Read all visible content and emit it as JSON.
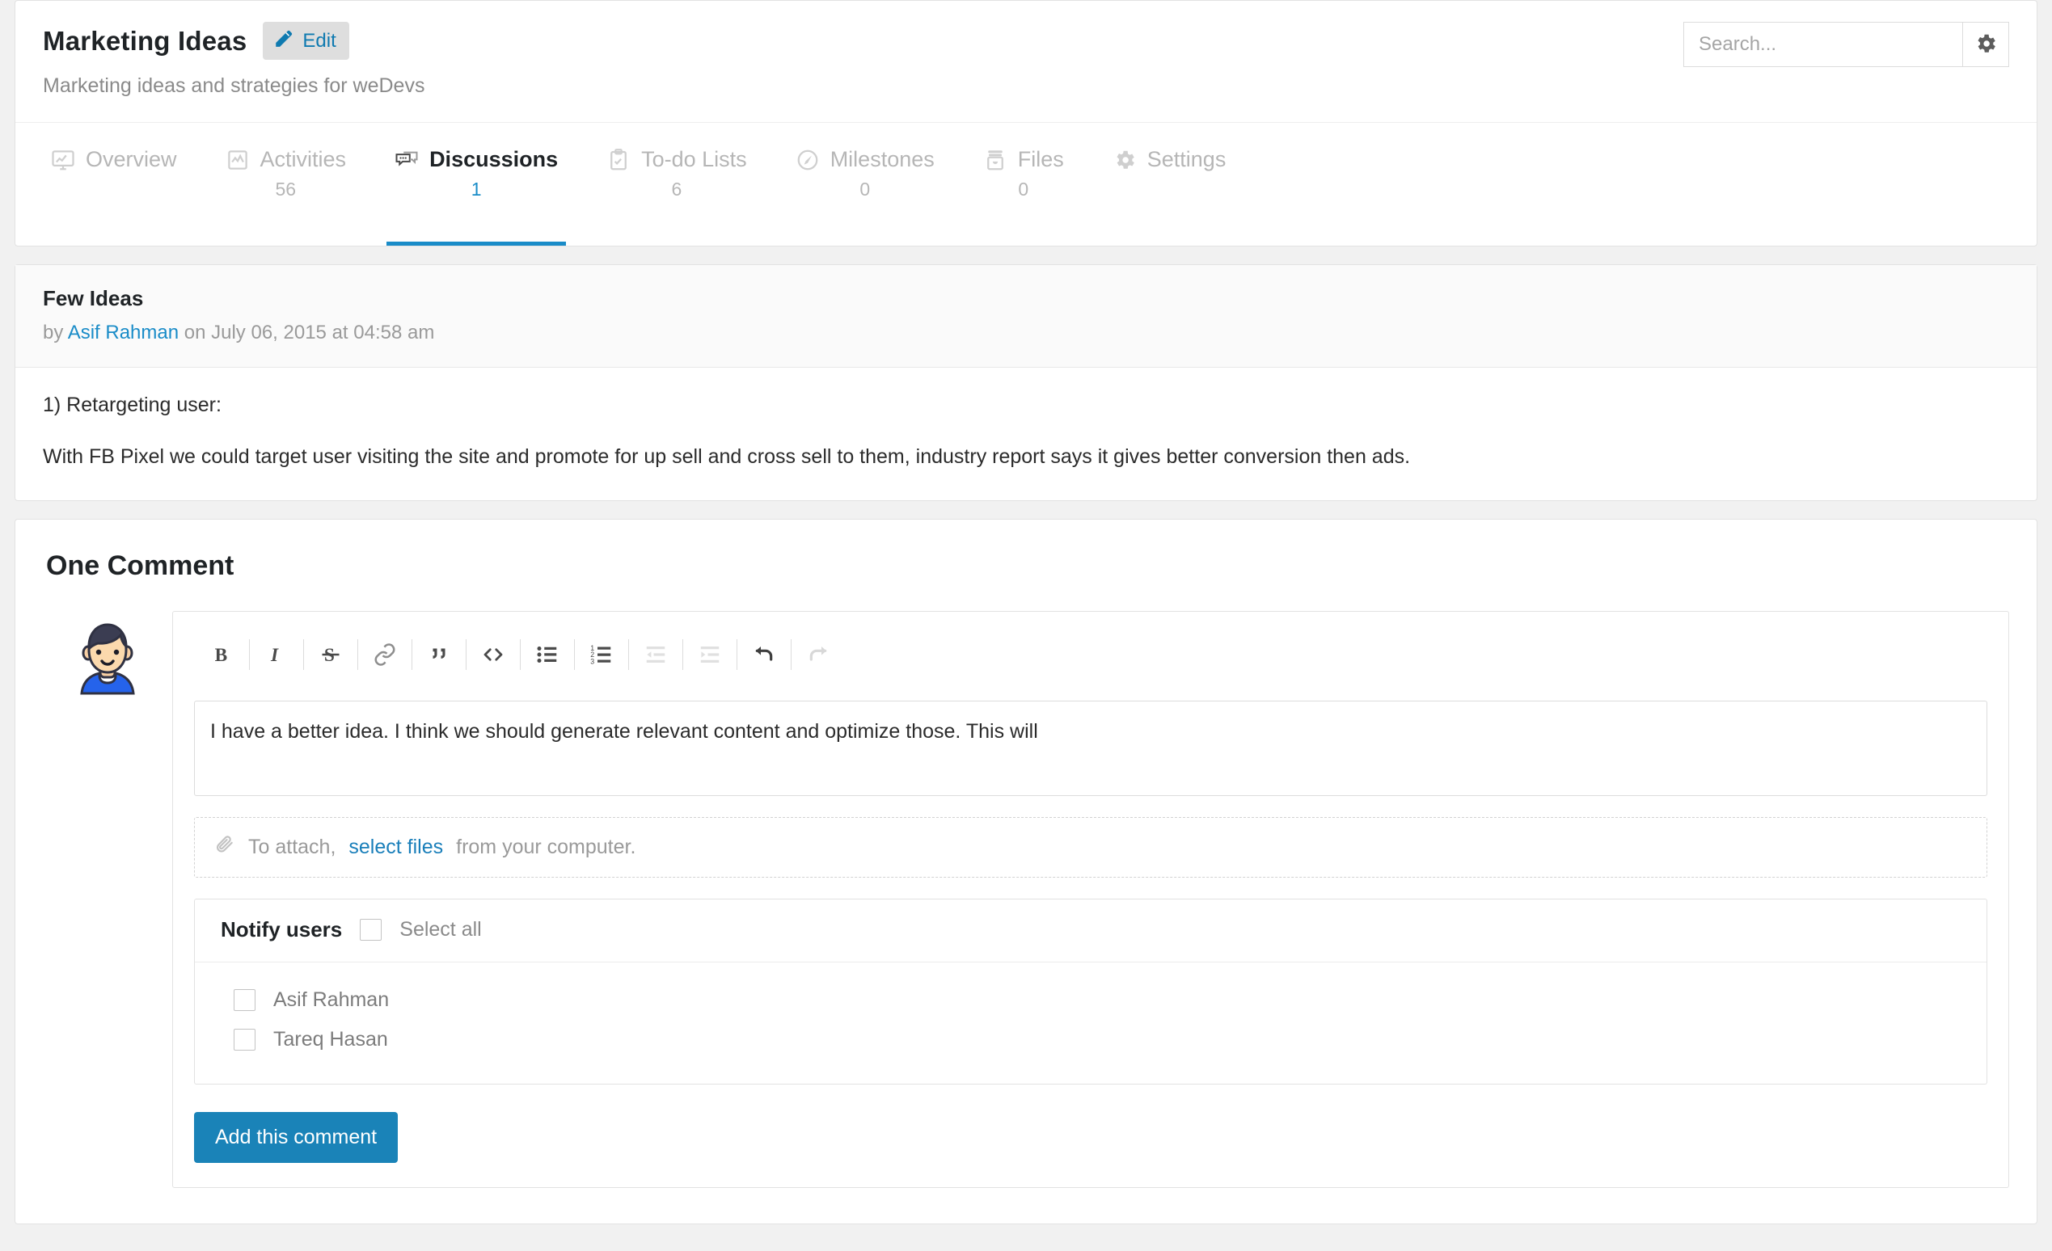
{
  "header": {
    "project_title": "Marketing Ideas",
    "edit_label": "Edit",
    "edit_icon": "pencil-icon",
    "project_subtitle": "Marketing ideas and strategies for weDevs",
    "search_placeholder": "Search...",
    "search_value": "",
    "settings_icon": "gear-icon"
  },
  "tabs": [
    {
      "label": "Overview",
      "count": "",
      "icon": "monitor-chart-icon",
      "active": false
    },
    {
      "label": "Activities",
      "count": "56",
      "icon": "activity-graph-icon",
      "active": false
    },
    {
      "label": "Discussions",
      "count": "1",
      "icon": "comment-bubbles-icon",
      "active": true
    },
    {
      "label": "To-do Lists",
      "count": "6",
      "icon": "clipboard-check-icon",
      "active": false
    },
    {
      "label": "Milestones",
      "count": "0",
      "icon": "speedometer-icon",
      "active": false
    },
    {
      "label": "Files",
      "count": "0",
      "icon": "archive-box-icon",
      "active": false
    },
    {
      "label": "Settings",
      "count": "",
      "icon": "gear-icon",
      "active": false
    }
  ],
  "discussion": {
    "title": "Few Ideas",
    "by_prefix": "by",
    "author": "Asif Rahman",
    "date_text": "on July 06, 2015 at 04:58 am",
    "paragraphs": [
      "1) Retargeting user:",
      "With FB Pixel we could target user visiting the site and promote for up sell and cross sell to them, industry report says it gives better conversion then ads."
    ]
  },
  "comments": {
    "heading": "One Comment",
    "avatar_icon": "user-avatar-illustration",
    "toolbar": [
      {
        "name": "bold-icon",
        "title": "Bold",
        "disabled": false
      },
      {
        "name": "italic-icon",
        "title": "Italic",
        "disabled": false
      },
      {
        "name": "strikethrough-icon",
        "title": "Strikethrough",
        "disabled": false
      },
      {
        "name": "link-icon",
        "title": "Link",
        "disabled": false
      },
      {
        "name": "quote-icon",
        "title": "Blockquote",
        "disabled": false
      },
      {
        "name": "code-icon",
        "title": "Code",
        "disabled": false
      },
      {
        "name": "bullet-list-icon",
        "title": "Bulleted list",
        "disabled": false
      },
      {
        "name": "numbered-list-icon",
        "title": "Numbered list",
        "disabled": false
      },
      {
        "name": "outdent-icon",
        "title": "Outdent",
        "disabled": true
      },
      {
        "name": "indent-icon",
        "title": "Indent",
        "disabled": true
      },
      {
        "name": "undo-icon",
        "title": "Undo",
        "disabled": false
      },
      {
        "name": "redo-icon",
        "title": "Redo",
        "disabled": true
      }
    ],
    "comment_value": "I have a better idea. I think we should generate relevant content and optimize those. This will",
    "comment_placeholder": "",
    "attach": {
      "icon": "paperclip-icon",
      "prefix": "To attach,",
      "link": "select files",
      "suffix": "from your computer."
    },
    "notify": {
      "title": "Notify users",
      "select_all_label": "Select all",
      "select_all_checked": false,
      "users": [
        {
          "name": "Asif Rahman",
          "checked": false
        },
        {
          "name": "Tareq Hasan",
          "checked": false
        }
      ]
    },
    "submit_label": "Add this comment"
  },
  "colors": {
    "accent": "#1a8cc8",
    "button": "#1a83b8",
    "link": "#1a7fba",
    "page_bg": "#f1f1f1",
    "muted": "#b6b6b6"
  }
}
